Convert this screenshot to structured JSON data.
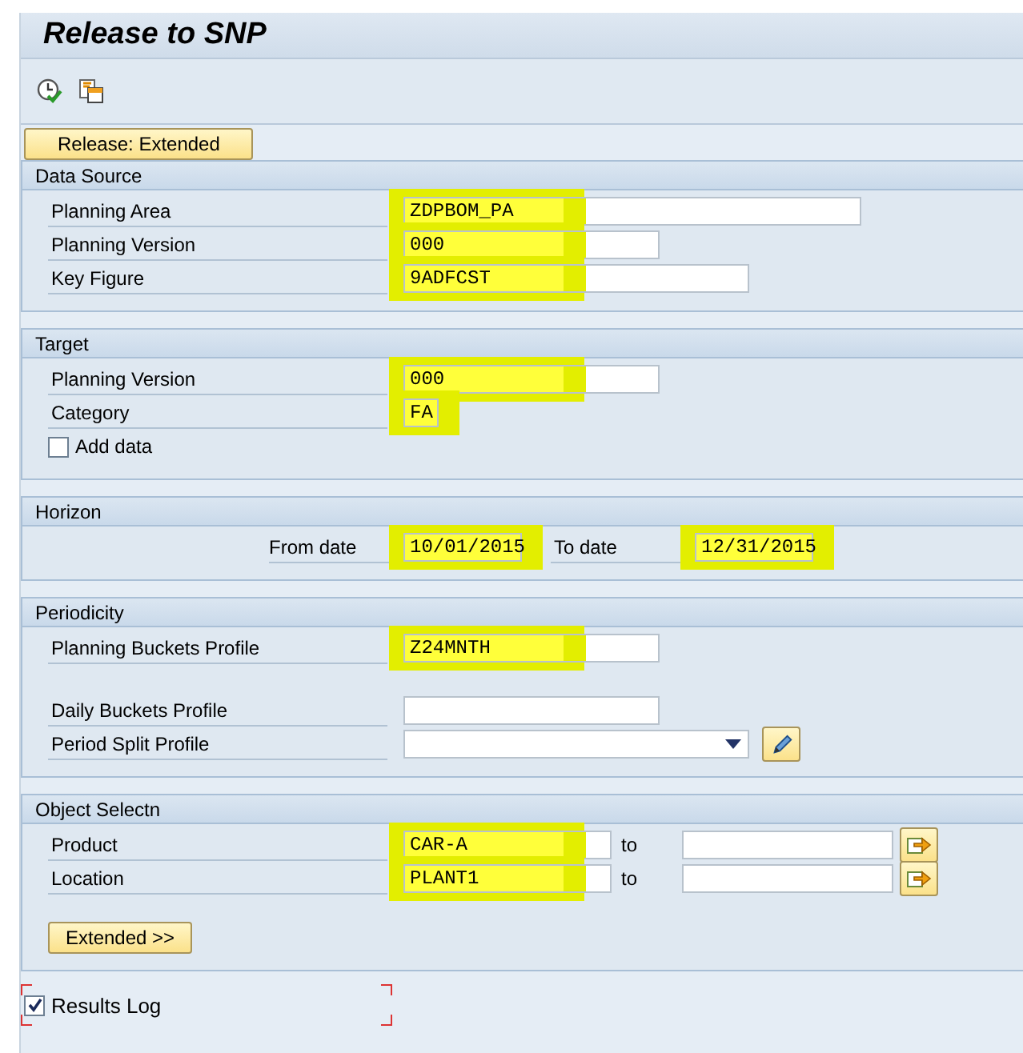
{
  "title": "Release to SNP",
  "top_button": "Release: Extended",
  "sections": [
    {
      "title": "Data Source",
      "rows": [
        {
          "kind": "field",
          "label": "Planning Area",
          "value": "ZDPBOM_PA",
          "highlighted": true
        },
        {
          "kind": "field",
          "label": "Planning Version",
          "value": "000",
          "highlighted": true
        },
        {
          "kind": "field",
          "label": "Key Figure",
          "value": "9ADFCST",
          "highlighted": true
        }
      ]
    },
    {
      "title": "Target",
      "rows": [
        {
          "kind": "field",
          "label": "Planning Version",
          "value": "000",
          "highlighted": true
        },
        {
          "kind": "field",
          "label": "Category",
          "value": "FA",
          "highlighted": true
        },
        {
          "kind": "checkbox",
          "label": "Add data",
          "checked": false
        }
      ]
    },
    {
      "title": "Horizon",
      "rows": [
        {
          "kind": "range",
          "label": "From date",
          "value": "10/01/2015",
          "to_label": "To date",
          "to_value": "12/31/2015",
          "highlighted": true
        }
      ]
    },
    {
      "title": "Periodicity",
      "rows": [
        {
          "kind": "field",
          "label": "Planning Buckets Profile",
          "value": "Z24MNTH",
          "highlighted": true
        },
        {
          "kind": "field",
          "label": "Daily Buckets Profile",
          "highlighted": false,
          "gap_before": true
        },
        {
          "kind": "dropdown",
          "label": "Period Split Profile",
          "highlighted": false
        }
      ]
    },
    {
      "title": "Object Selectn",
      "rows": [
        {
          "kind": "select",
          "label": "Product",
          "value": "CAR-A",
          "to_label": "to",
          "highlighted": true
        },
        {
          "kind": "select",
          "label": "Location",
          "value": "PLANT1",
          "to_label": "to",
          "highlighted": true
        },
        {
          "kind": "button",
          "label": "Extended >>"
        }
      ]
    }
  ],
  "results_log": {
    "label": "Results Log",
    "checked": true
  }
}
